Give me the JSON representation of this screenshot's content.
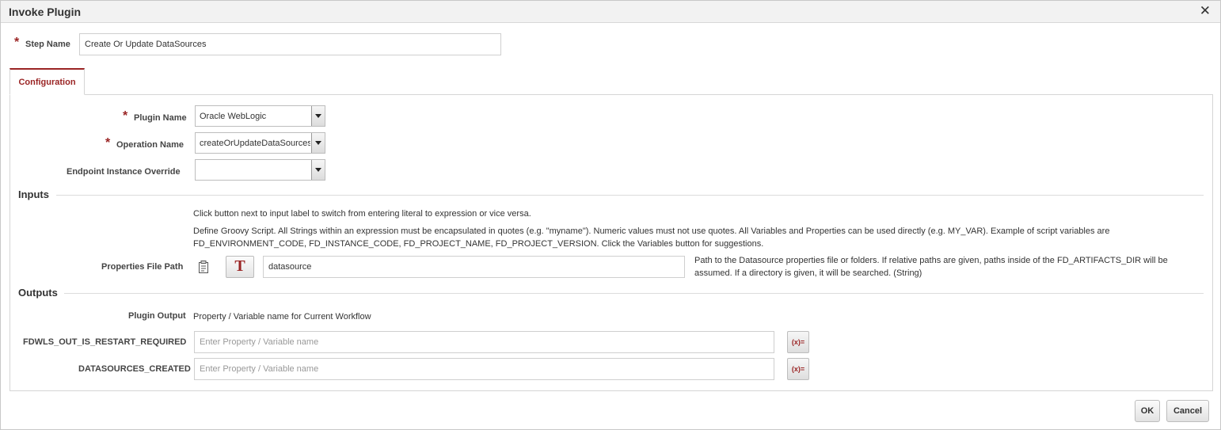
{
  "dialog": {
    "title": "Invoke Plugin",
    "close_glyph": "✕"
  },
  "step": {
    "required_mark": "*",
    "label": "Step Name",
    "value": "Create Or Update DataSources"
  },
  "tabs": [
    {
      "label": "Configuration",
      "active": true
    }
  ],
  "config": {
    "plugin_name": {
      "required_mark": "*",
      "label": "Plugin Name",
      "value": "Oracle WebLogic"
    },
    "operation_name": {
      "required_mark": "*",
      "label": "Operation Name",
      "value": "createOrUpdateDataSources"
    },
    "endpoint_override": {
      "label": "Endpoint Instance Override",
      "value": ""
    }
  },
  "inputs": {
    "heading": "Inputs",
    "hint": "Click button next to input label to switch from entering literal to expression or vice versa.",
    "groovy_help": "Define Groovy Script. All Strings within an expression must be encapsulated in quotes (e.g. \"myname\"). Numeric values must not use quotes. All Variables and Properties can be used directly (e.g. MY_VAR). Example of script variables are FD_ENVIRONMENT_CODE, FD_INSTANCE_CODE, FD_PROJECT_NAME, FD_PROJECT_VERSION. Click the Variables button for suggestions.",
    "properties_file_path": {
      "label": "Properties File Path",
      "mode_glyph": "T",
      "value": "datasource",
      "help": "Path to the Datasource properties file or folders. If relative paths are given, paths inside of the FD_ARTIFACTS_DIR will be assumed. If a directory is given, it will be searched. (String)"
    }
  },
  "outputs": {
    "heading": "Outputs",
    "plugin_output_label": "Plugin Output",
    "plugin_output_desc": "Property / Variable name for Current Workflow",
    "rows": [
      {
        "label": "FDWLS_OUT_IS_RESTART_REQUIRED",
        "placeholder": "Enter Property / Variable name",
        "var_button": "(x)="
      },
      {
        "label": "DATASOURCES_CREATED",
        "placeholder": "Enter Property / Variable name",
        "var_button": "(x)="
      }
    ]
  },
  "footer": {
    "ok_label": "OK",
    "cancel_label": "Cancel"
  },
  "colors": {
    "accent": "#9a2424",
    "border": "#d5d5d5",
    "titlebar": "#f2f2f2"
  }
}
